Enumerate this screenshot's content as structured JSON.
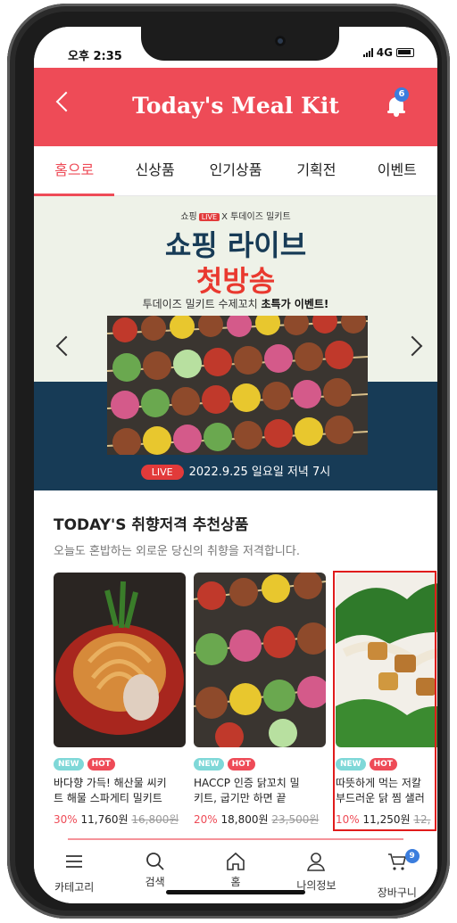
{
  "status_bar": {
    "time": "오후 2:35",
    "network": "4G"
  },
  "header": {
    "title": "Today's Meal Kit",
    "notification_count": "6"
  },
  "tabs": [
    {
      "label": "홈으로",
      "active": true
    },
    {
      "label": "신상품",
      "active": false
    },
    {
      "label": "인기상품",
      "active": false
    },
    {
      "label": "기획전",
      "active": false
    },
    {
      "label": "이벤트",
      "active": false
    }
  ],
  "banner": {
    "top_left": "쇼핑",
    "live_badge": "LIVE",
    "top_right": "X 투데이즈 밀키트",
    "headline_1": "쇼핑 라이브",
    "headline_2": "첫방송",
    "event_text": "투데이즈 밀키트 수제꼬치",
    "event_emphasis": "초특가 이벤트!",
    "live_pill": "LIVE",
    "live_date": "2022.9.25 일요일 저녁 7시"
  },
  "section": {
    "title": "TODAY'S 취향저격 추천상품",
    "subtitle": "오늘도 혼밥하는 외로운 당신의 취향을 저격합니다."
  },
  "products": [
    {
      "tag_new": "NEW",
      "tag_hot": "HOT",
      "name_line1": "바다향 가득! 해산물 씨키",
      "name_line2": "트 해물 스파게티 밀키트",
      "discount": "30%",
      "price": "11,760원",
      "original_price": "16,800원"
    },
    {
      "tag_new": "NEW",
      "tag_hot": "HOT",
      "name_line1": "HACCP 인증 닭꼬치 밀",
      "name_line2": "키트, 굽기만 하면 끝",
      "discount": "20%",
      "price": "18,800원",
      "original_price": "23,500원"
    },
    {
      "tag_new": "NEW",
      "tag_hot": "HOT",
      "name_line1": "따뜻하게 먹는 저칼",
      "name_line2": "부드러운 닭 찜 샐러",
      "discount": "10%",
      "price": "11,250원",
      "original_price": "12,"
    }
  ],
  "bottom_nav": [
    {
      "label": "카테고리",
      "icon": "menu-icon"
    },
    {
      "label": "검색",
      "icon": "search-icon"
    },
    {
      "label": "홈",
      "icon": "home-icon"
    },
    {
      "label": "나의정보",
      "icon": "user-icon"
    },
    {
      "label": "장바구니",
      "icon": "cart-icon",
      "badge": "9"
    }
  ],
  "colors": {
    "brand": "#ee4b57",
    "navy": "#173b56",
    "badge_blue": "#3b7ddd",
    "new_tag": "#7fd8d8"
  }
}
